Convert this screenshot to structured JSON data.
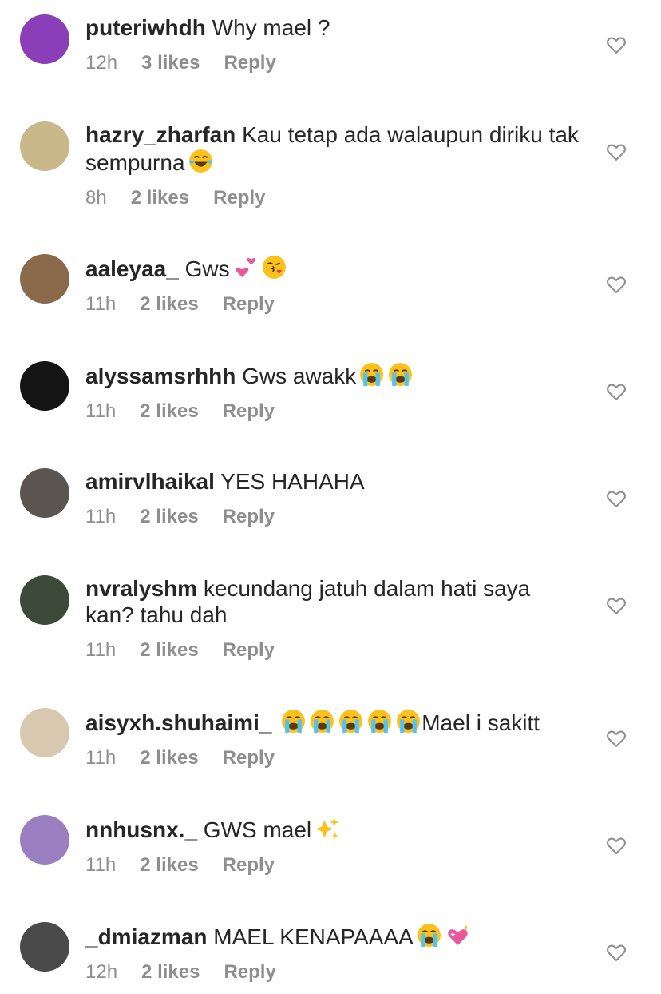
{
  "comments": [
    {
      "username": "puteriwhdh",
      "text": "Why mael ?",
      "time": "12h",
      "likes": "3 likes",
      "reply": "Reply",
      "avatar_color": "#8a3fb8",
      "emojis": []
    },
    {
      "username": "hazry_zharfan",
      "text": "Kau tetap ada walaupun diriku tak sempurna",
      "time": "8h",
      "likes": "2 likes",
      "reply": "Reply",
      "avatar_color": "#c9b98a",
      "emojis": [
        "laughing-emoji"
      ]
    },
    {
      "username": "aaleyaa_",
      "text": "Gws",
      "time": "11h",
      "likes": "2 likes",
      "reply": "Reply",
      "avatar_color": "#8a6a4a",
      "emojis": [
        "two-hearts-emoji",
        "kiss-emoji"
      ]
    },
    {
      "username": "alyssamsrhhh",
      "text": "Gws awakk",
      "time": "11h",
      "likes": "2 likes",
      "reply": "Reply",
      "avatar_color": "#141414",
      "emojis": [
        "crying-emoji",
        "crying-emoji"
      ]
    },
    {
      "username": "amirvlhaikal",
      "text": "YES HAHAHA",
      "time": "11h",
      "likes": "2 likes",
      "reply": "Reply",
      "avatar_color": "#5a5550",
      "emojis": []
    },
    {
      "username": "nvralyshm",
      "text": "kecundang jatuh dalam hati saya kan? tahu dah",
      "time": "11h",
      "likes": "2 likes",
      "reply": "Reply",
      "avatar_color": "#3d4a3a",
      "emojis": []
    },
    {
      "username": "aisyxh.shuhaimi_",
      "text": "Mael i sakitt",
      "time": "11h",
      "likes": "2 likes",
      "reply": "Reply",
      "avatar_color": "#d8c8b0",
      "emojis_before": [
        "crying-emoji",
        "crying-emoji",
        "crying-emoji",
        "crying-emoji",
        "crying-emoji"
      ],
      "emojis": []
    },
    {
      "username": "nnhusnx._",
      "text": "GWS mael",
      "time": "11h",
      "likes": "2 likes",
      "reply": "Reply",
      "avatar_color": "#9a7fc0",
      "emojis": [
        "sparkles-emoji"
      ]
    },
    {
      "username": "_dmiazman",
      "text": "MAEL KENAPAAAA",
      "time": "12h",
      "likes": "2 likes",
      "reply": "Reply",
      "avatar_color": "#4a4a4a",
      "emojis": [
        "crying-emoji",
        "sparkling-heart-emoji"
      ]
    }
  ],
  "colors": {
    "text": "#262626",
    "meta": "#8e8e8e",
    "heart_stroke": "#8e8e8e"
  }
}
